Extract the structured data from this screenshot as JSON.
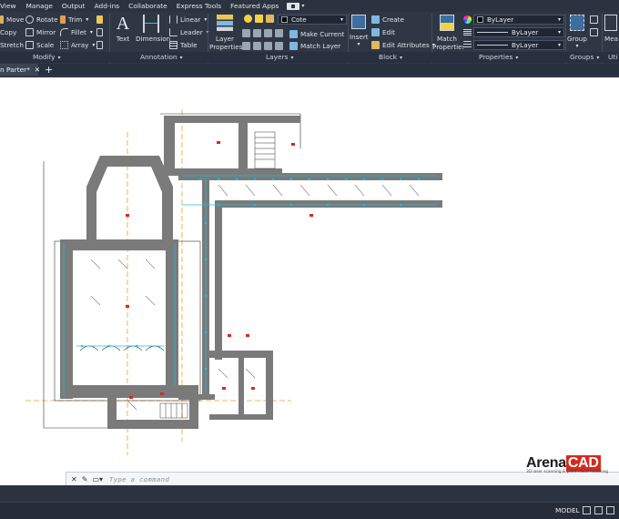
{
  "menu": [
    "View",
    "Manage",
    "Output",
    "Add-ins",
    "Collaborate",
    "Express Tools",
    "Featured Apps"
  ],
  "modify": {
    "move": "Move",
    "rotate": "Rotate",
    "trim": "Trim",
    "copy": "Copy",
    "mirror": "Mirror",
    "fillet": "Fillet",
    "stretch": "Stretch",
    "scale": "Scale",
    "array": "Array",
    "title": "Modify"
  },
  "annotation": {
    "text": "Text",
    "dimension": "Dimension",
    "linear": "Linear",
    "leader": "Leader",
    "table": "Table",
    "title": "Annotation"
  },
  "layers": {
    "properties": [
      "Layer",
      "Properties"
    ],
    "current_layer": "Cote",
    "make_current": "Make Current",
    "match_layer": "Match Layer",
    "title": "Layers"
  },
  "block": {
    "insert": "Insert",
    "create": "Create",
    "edit": "Edit",
    "edit_attributes": "Edit Attributes",
    "title": "Block"
  },
  "properties": {
    "match": [
      "Match",
      "Properties"
    ],
    "color": "ByLayer",
    "linetype": "ByLayer",
    "lineweight": "ByLayer",
    "title": "Properties"
  },
  "groups": {
    "group": "Group",
    "title": "Groups"
  },
  "utilities": {
    "measure": "Mea",
    "title": "Uti"
  },
  "tab": {
    "name": "n Parter*"
  },
  "command": {
    "placeholder": "Type a command"
  },
  "brand": {
    "name_a": "Arena",
    "name_b": "CAD",
    "tagline": "3D laser scanning & point cloud modeling"
  },
  "status": {
    "model": "MODEL"
  },
  "colors": {
    "ribbon": "#2f3745",
    "accent_red": "#d42a1d",
    "guide": "#f0a02a",
    "dims": "#19c0e0"
  }
}
